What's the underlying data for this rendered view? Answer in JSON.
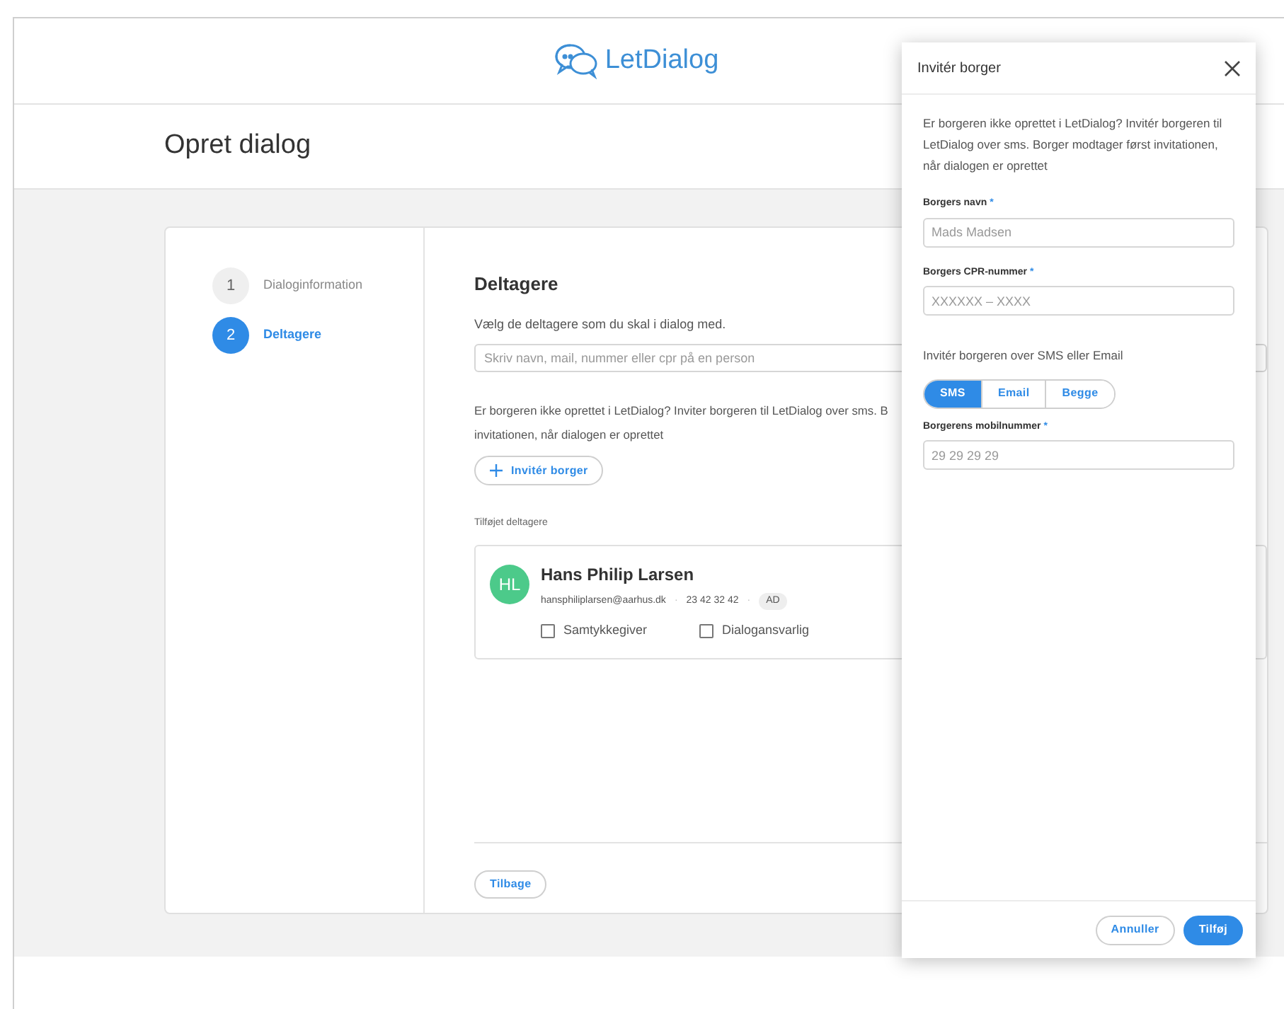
{
  "header": {
    "logo": "LetDialog"
  },
  "page": {
    "title": "Opret dialog"
  },
  "steps": [
    {
      "number": "1",
      "label": "Dialoginformation",
      "selected": false
    },
    {
      "number": "2",
      "label": "Deltagere",
      "selected": true
    }
  ],
  "participants": {
    "heading": "Deltagere",
    "description": "Vælg de deltagere som du skal i dialog med.",
    "search": {
      "placeholder": "Skriv navn, mail, nummer eller cpr på en person"
    },
    "invite_text_lines": [
      "Er borgeren ikke oprettet i LetDialog? Inviter borgeren til LetDialog over sms. B",
      "invitationen, når dialogen er oprettet"
    ],
    "invite_button": "Invitér borger",
    "added_label": "Tilføjet deltagere",
    "added": [
      {
        "initials": "HL",
        "name": "Hans Philip Larsen",
        "email": "hansphiliplarsen@aarhus.dk",
        "phone": "23 42 32 42",
        "separator": "·",
        "tag": "AD",
        "options": [
          {
            "label": "Samtykkegiver",
            "checked": false
          },
          {
            "label": "Dialogansvarlig",
            "checked": false
          }
        ]
      }
    ],
    "back_button": "Tilbage"
  },
  "invite_panel": {
    "title": "Invitér borger",
    "intro": "Er borgeren ikke oprettet i LetDialog? Invitér borgeren til LetDialog over sms. Borger modtager først invitationen, når dialogen er oprettet",
    "fields": [
      {
        "label": "Borgers navn",
        "required_mark": "*",
        "placeholder": "Mads Madsen"
      },
      {
        "label": "Borgers CPR-nummer",
        "required_mark": "*",
        "placeholder": "XXXXXX – XXXX"
      }
    ],
    "method_label": "Invitér borgeren over SMS eller Email",
    "methods": [
      {
        "label": "SMS",
        "selected": true
      },
      {
        "label": "Email",
        "selected": false
      },
      {
        "label": "Begge",
        "selected": false
      }
    ],
    "mobile_field": {
      "label": "Borgerens mobilnummer",
      "required_mark": "*",
      "placeholder": "29 29 29 29"
    },
    "buttons": [
      {
        "label": "Annuller",
        "kind": "secondary"
      },
      {
        "label": "Tilføj",
        "kind": "primary"
      }
    ]
  }
}
